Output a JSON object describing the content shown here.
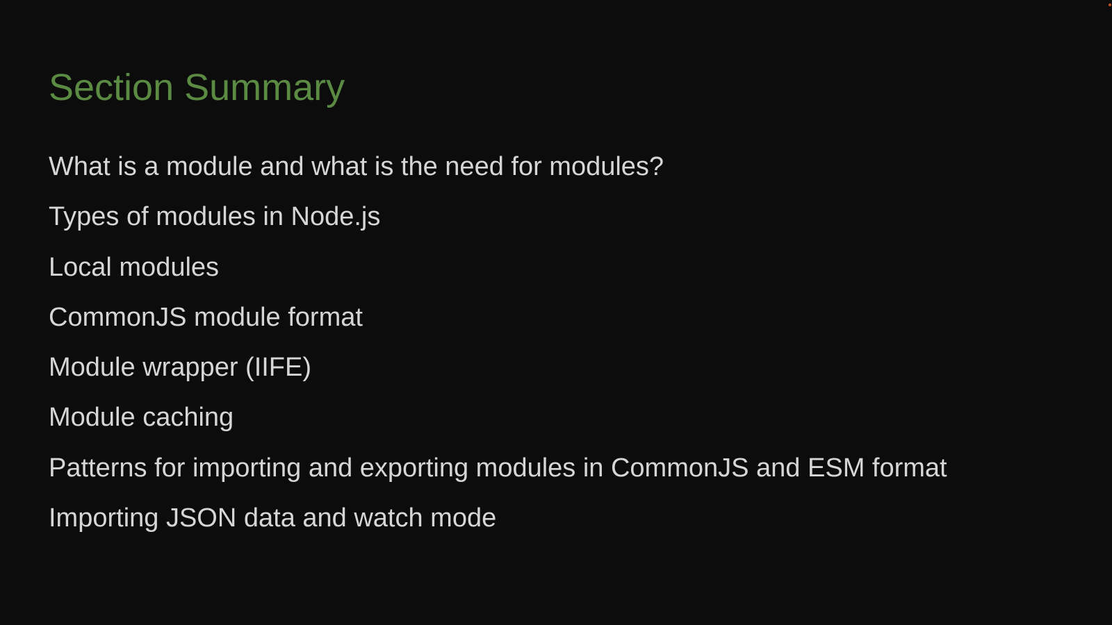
{
  "slide": {
    "title": "Section Summary",
    "items": [
      "What is a module and what is the need for modules?",
      "Types of modules in Node.js",
      "Local modules",
      "CommonJS module format",
      "Module wrapper (IIFE)",
      "Module caching",
      "Patterns for importing and exporting modules in CommonJS and ESM format",
      "Importing JSON data and watch mode"
    ]
  },
  "colors": {
    "background": "#0c0c0c",
    "title": "#5b8b43",
    "body_text": "#d6d6d6",
    "corner_dot": "#c0501e"
  }
}
